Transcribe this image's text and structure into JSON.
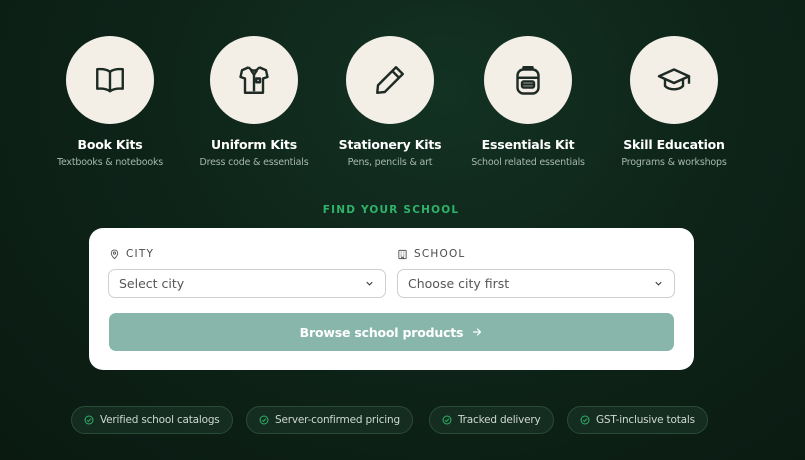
{
  "categories": [
    {
      "title": "Book Kits",
      "subtitle": "Textbooks & notebooks",
      "icon": "book-icon"
    },
    {
      "title": "Uniform Kits",
      "subtitle": "Dress code & essentials",
      "icon": "shirt-icon"
    },
    {
      "title": "Stationery Kits",
      "subtitle": "Pens, pencils & art",
      "icon": "pencil-icon"
    },
    {
      "title": "Essentials Kit",
      "subtitle": "School related essentials",
      "icon": "backpack-icon"
    },
    {
      "title": "Skill Education",
      "subtitle": "Programs & workshops",
      "icon": "graduation-cap-icon"
    }
  ],
  "finder": {
    "heading": "FIND YOUR SCHOOL",
    "city_label": "CITY",
    "city_placeholder": "Select city",
    "school_label": "SCHOOL",
    "school_placeholder": "Choose city first",
    "browse_label": "Browse school products"
  },
  "badges": [
    "Verified school catalogs",
    "Server-confirmed pricing",
    "Tracked delivery",
    "GST-inclusive totals"
  ],
  "colors": {
    "background": "#0e2419",
    "accent_green": "#2fb36a",
    "circle_bg": "#f3efe6",
    "button_bg": "#88b6aa"
  }
}
